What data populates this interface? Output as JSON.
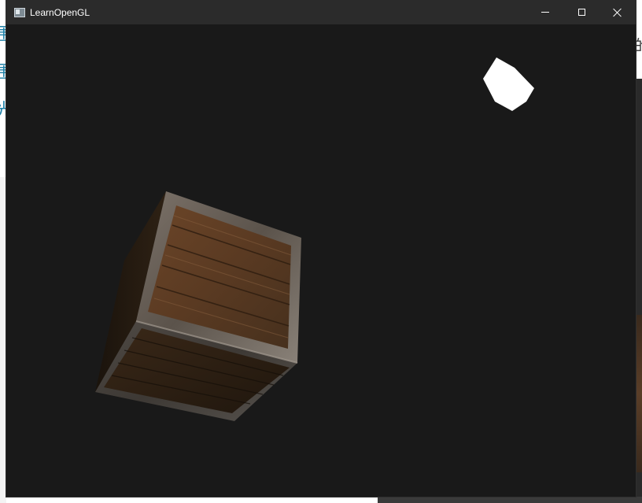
{
  "window": {
    "title": "LearnOpenGL",
    "controls": {
      "minimize_icon": "minimize-icon",
      "maximize_icon": "maximize-icon",
      "close_icon": "close-icon"
    }
  },
  "background_fragments": {
    "left_glyphs": [
      "围",
      "围",
      "光"
    ],
    "right_glyph": "的"
  },
  "scene": {
    "clear_color": "#191919",
    "light_cube_color": "#ffffff",
    "crate_wood_color": "#5a3a22",
    "crate_metal_color": "#6e655c"
  }
}
